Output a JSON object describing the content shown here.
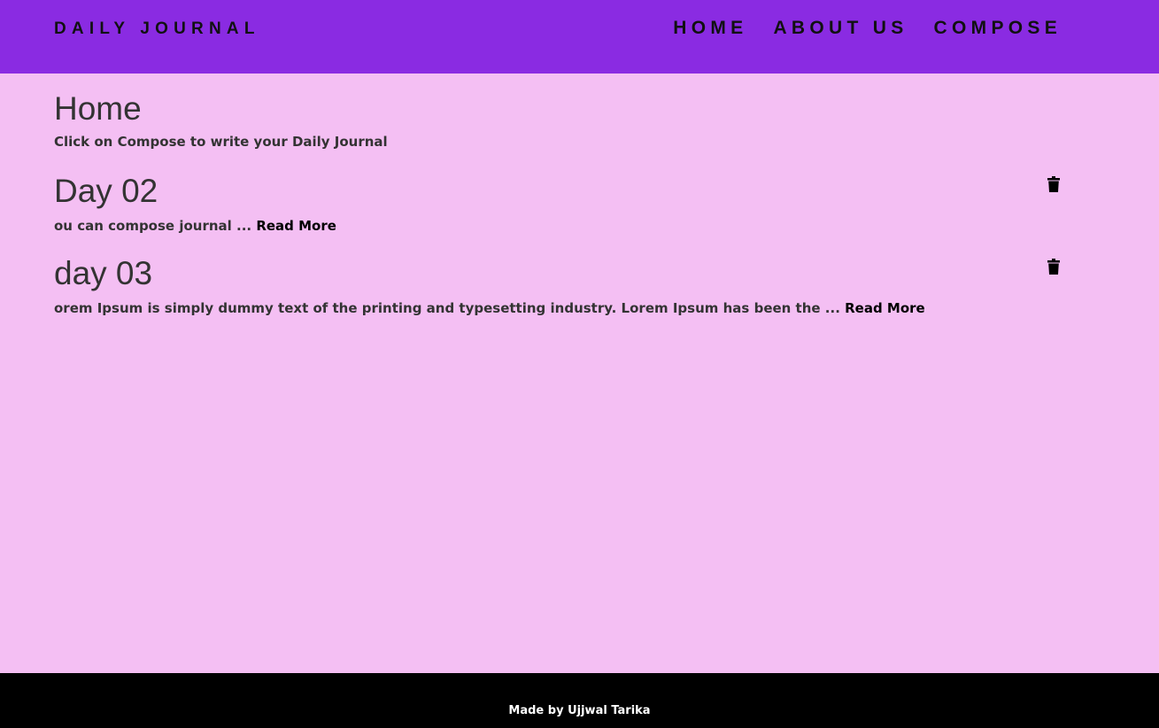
{
  "navbar": {
    "brand": "DAILY JOURNAL",
    "links": [
      "HOME",
      "ABOUT US",
      "COMPOSE"
    ],
    "color": "#8a2be2"
  },
  "page": {
    "title": "Home",
    "intro": "Click on Compose to write your Daily Journal",
    "background": "#f4bff3"
  },
  "posts": [
    {
      "title": "Day 02",
      "excerpt": "ou can compose journal ... ",
      "read_more": "Read More",
      "delete_icon": "trash-icon"
    },
    {
      "title": "day 03",
      "excerpt": "orem Ipsum is simply dummy text of the printing and typesetting industry. Lorem Ipsum has been the ... ",
      "read_more": "Read More",
      "delete_icon": "trash-icon"
    }
  ],
  "footer": {
    "text": "Made by Ujjwal Tarika"
  }
}
